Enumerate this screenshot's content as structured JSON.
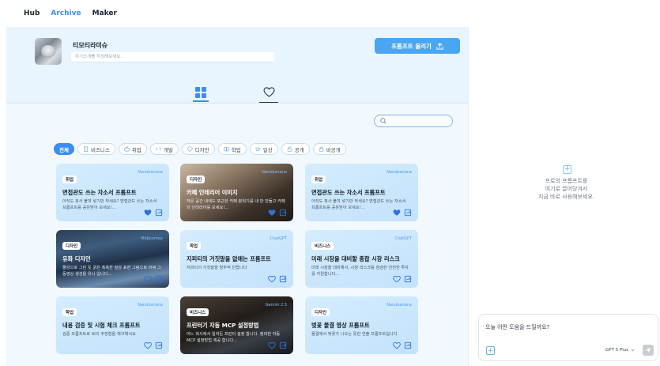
{
  "nav": {
    "items": [
      {
        "label": "Hub",
        "active": false
      },
      {
        "label": "Archive",
        "active": true
      },
      {
        "label": "Maker",
        "active": false
      }
    ]
  },
  "profile": {
    "name": "티모티라미슈",
    "intro_placeholder": "자기소개를 작성해보세요."
  },
  "upload_button": {
    "label": "프롬프트 올리기"
  },
  "categories": [
    {
      "label": "전체",
      "icon": "none",
      "active": true
    },
    {
      "label": "비즈니스",
      "icon": "building-icon",
      "active": false
    },
    {
      "label": "취업",
      "icon": "briefcase-icon",
      "active": false
    },
    {
      "label": "개발",
      "icon": "code-icon",
      "active": false
    },
    {
      "label": "디자인",
      "icon": "palette-icon",
      "active": false
    },
    {
      "label": "학업",
      "icon": "book-icon",
      "active": false
    },
    {
      "label": "일상",
      "icon": "cup-icon",
      "active": false
    },
    {
      "label": "공개",
      "icon": "lock-open-icon",
      "active": false
    },
    {
      "label": "비공개",
      "icon": "lock-icon",
      "active": false
    }
  ],
  "cards": [
    {
      "category": "취업",
      "model": "Nanobanana",
      "title": "면접관도 쓰는 자소서 프롬프트",
      "desc": "아직도 복사 붙여 넣기만 하세요? 면접관도 쓰는 자소서 프롬프트를 공유받아 보세요!...",
      "liked": true,
      "style": "light"
    },
    {
      "category": "디자인",
      "model": "Nanobanana",
      "title": "카페 인테리어 이미지",
      "desc": "작은 공간 내에도 포근한 카페 분위기를 내 만 만들고 카페의 인테리어를 보세요!...",
      "liked": true,
      "style": "cafe"
    },
    {
      "category": "취업",
      "model": "Nanobanana",
      "title": "면접관도 쓰는 자소서 프롬프트",
      "desc": "아직도 복사 붙여 넣기만 하세요? 면접관도 쓰는 자소서 프롬프트를 공유받아 보세요!...",
      "liked": true,
      "style": "light"
    },
    {
      "category": "디자인",
      "model": "Midjourney",
      "title": "유화 디자인",
      "desc": "물감으로 그린 듯 굵은 촉촉한 질감 표현 그림으로 바꿔 그 동영상 생성을 유니 입니다...",
      "liked": false,
      "style": "ocean"
    },
    {
      "category": "학업",
      "model": "ChatGPT",
      "title": "지피티의 거짓말을 없애는 프롬프트",
      "desc": "지피티의 거짓말을 방추적 만듭니다",
      "liked": false,
      "style": "light"
    },
    {
      "category": "비즈니스",
      "model": "ChatGPT",
      "title": "미래 시장을 대비할 종합 시장 리스크",
      "desc": "미래 시장을 대비해서, 시장 리스크를 점검한 안전한 투자를 지원합니다...",
      "liked": false,
      "style": "light"
    },
    {
      "category": "학업",
      "model": "Nanobanana",
      "title": "내용 검증 및 시험 체크 프롬프트",
      "desc": "검증 프롬프트로 AI의 주장함을 체크해서요",
      "liked": false,
      "style": "light"
    },
    {
      "category": "비즈니스",
      "model": "Gemini 2.5",
      "title": "프린터기 자동 MCP 설정방법",
      "desc": "어느 회사에서 일하든 프린터 설정 합니다. 정리한 자동 MCP 설정방법 제공 합니다...",
      "liked": false,
      "style": "printer"
    },
    {
      "category": "디자인",
      "model": "Nanobanana",
      "title": "벚꽃 물결 영상 프롬프트",
      "desc": "물결에서 벚꽃가 나오는 뜻한 연출 프롬프트입니다",
      "liked": false,
      "style": "light"
    }
  ],
  "right_panel": {
    "drop_hint": "프로의 프롬프트를\n여기로 끌어당겨서\n지금 바로 사용해보세요.",
    "chat_placeholder": "오늘 어떤 도움을 드릴까요?",
    "model_label": "GPT 5 Plus"
  },
  "colors": {
    "accent": "#3b8ef0",
    "card_bg": "#cfe8fd",
    "panel_bg": "#f1f9ff"
  }
}
